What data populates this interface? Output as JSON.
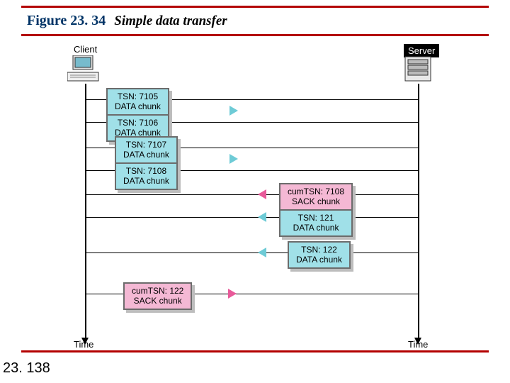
{
  "figure": {
    "number": "Figure 23. 34",
    "title": "Simple data transfer"
  },
  "page_number": "23. 138",
  "labels": {
    "client": "Client",
    "server": "Server",
    "time": "Time"
  },
  "chunks": {
    "c1a": {
      "tsn": "TSN: 7105",
      "type": "DATA chunk"
    },
    "c1b": {
      "tsn": "TSN: 7106",
      "type": "DATA chunk"
    },
    "c2a": {
      "tsn": "TSN: 7107",
      "type": "DATA chunk"
    },
    "c2b": {
      "tsn": "TSN: 7108",
      "type": "DATA chunk"
    },
    "s1": {
      "tsn": "cumTSN: 7108",
      "type": "SACK chunk"
    },
    "d1": {
      "tsn": "TSN: 121",
      "type": "DATA chunk"
    },
    "d2": {
      "tsn": "TSN: 122",
      "type": "DATA chunk"
    },
    "s2": {
      "tsn": "cumTSN: 122",
      "type": "SACK chunk"
    }
  }
}
